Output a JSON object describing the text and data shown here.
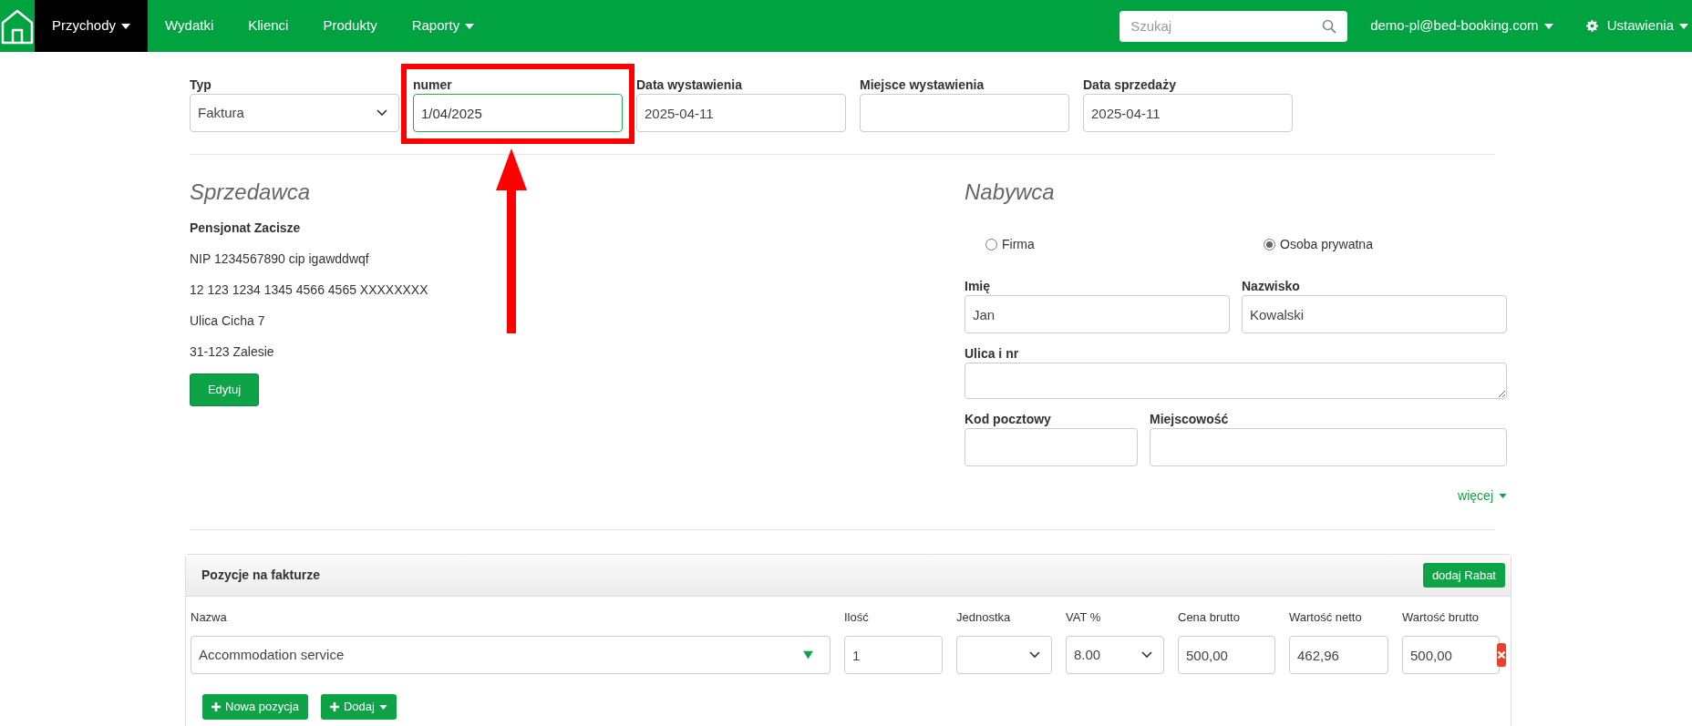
{
  "navbar": {
    "menu": [
      {
        "label": "Przychody",
        "selected": true,
        "dropdown": true
      },
      {
        "label": "Wydatki",
        "selected": false,
        "dropdown": false
      },
      {
        "label": "Klienci",
        "selected": false,
        "dropdown": false
      },
      {
        "label": "Produkty",
        "selected": false,
        "dropdown": false
      },
      {
        "label": "Raporty",
        "selected": false,
        "dropdown": true
      }
    ],
    "search": {
      "placeholder": "Szukaj"
    },
    "account": "demo-pl@bed-booking.com",
    "settings": "Ustawienia"
  },
  "invoice_header": [
    {
      "label": "Typ",
      "kind": "select",
      "value": "Faktura",
      "focused": false
    },
    {
      "label": "numer",
      "kind": "input",
      "value": "1/04/2025",
      "focused": true
    },
    {
      "label": "Data wystawienia",
      "kind": "input",
      "value": "2025-04-11",
      "focused": false
    },
    {
      "label": "Miejsce wystawienia",
      "kind": "input",
      "focused": false
    },
    {
      "label": "Data sprzedaży",
      "kind": "input",
      "value": "2025-04-11",
      "focused": false
    }
  ],
  "seller": {
    "heading": "Sprzedawca",
    "name": "Pensjonat Zacisze",
    "lines": [
      "NIP 1234567890 cip igawddwqf",
      "12 123 1234 1345 4566 4565 XXXXXXXX",
      "Ulica Cicha 7",
      "31-123 Zalesie"
    ],
    "edit_button": "Edytuj"
  },
  "buyer": {
    "heading": "Nabywca",
    "options": [
      {
        "label": "Firma",
        "selected": false
      },
      {
        "label": "Osoba prywatna",
        "selected": true
      }
    ],
    "rows": [
      {
        "fields": [
          {
            "label": "Imię",
            "kind": "input",
            "value": "Jan"
          },
          {
            "label": "Nazwisko",
            "kind": "input",
            "value": "Kowalski"
          }
        ]
      },
      {
        "fields": [
          {
            "label": "Ulica i nr",
            "kind": "textarea"
          }
        ]
      },
      {
        "fields": [
          {
            "label": "Kod pocztowy",
            "kind": "input"
          },
          {
            "label": "Miejscowość",
            "kind": "input"
          }
        ]
      }
    ],
    "more_link": "więcej"
  },
  "items": {
    "title": "Pozycje na fakturze",
    "discount_button": "dodaj Rabat",
    "columns": [
      "Nazwa",
      "Ilość",
      "Jednostka",
      "VAT %",
      "Cena brutto",
      "Wartość netto",
      "Wartość brutto"
    ],
    "rows": [
      {
        "cells": [
          {
            "kind": "combo",
            "value": "Accommodation service"
          },
          {
            "kind": "input",
            "value": "1"
          },
          {
            "kind": "select"
          },
          {
            "kind": "select",
            "value": "8.00"
          },
          {
            "kind": "input",
            "value": "500,00"
          },
          {
            "kind": "input",
            "value": "462,96"
          },
          {
            "kind": "input",
            "value": "500,00"
          }
        ]
      }
    ],
    "buttons": [
      {
        "label": "Nowa pozycja",
        "dropdown": false
      },
      {
        "label": "Dodaj",
        "dropdown": true
      }
    ]
  }
}
